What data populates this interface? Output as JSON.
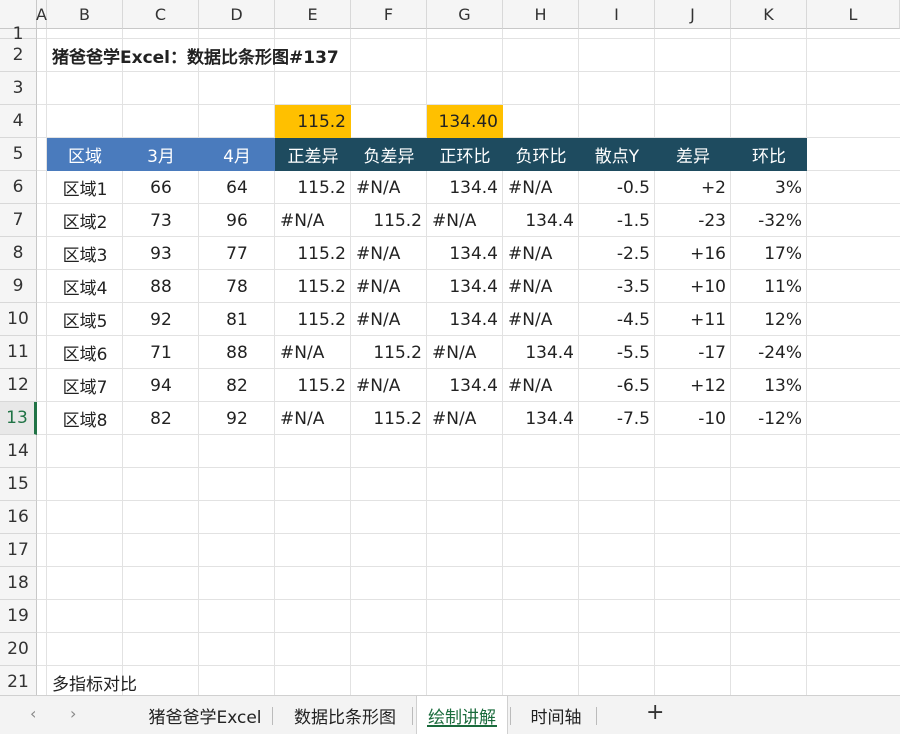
{
  "columns": [
    "A",
    "B",
    "C",
    "D",
    "E",
    "F",
    "G",
    "H",
    "I",
    "J",
    "K",
    "L"
  ],
  "rows": [
    "1",
    "2",
    "3",
    "4",
    "5",
    "6",
    "7",
    "8",
    "9",
    "10",
    "11",
    "12",
    "13",
    "14",
    "15",
    "16",
    "17",
    "18",
    "19",
    "20",
    "21"
  ],
  "active_row": "13",
  "title": "猪爸爸学Excel：数据比条形图#137",
  "highlight": {
    "e4": "115.2",
    "g4": "134.40"
  },
  "header": [
    "区域",
    "3月",
    "4月",
    "正差异",
    "负差异",
    "正环比",
    "负环比",
    "散点Y",
    "差异",
    "环比"
  ],
  "table": [
    [
      "区域1",
      "66",
      "64",
      "115.2",
      "#N/A",
      "134.4",
      "#N/A",
      "-0.5",
      "+2",
      "3%"
    ],
    [
      "区域2",
      "73",
      "96",
      "#N/A",
      "115.2",
      "#N/A",
      "134.4",
      "-1.5",
      "-23",
      "-32%"
    ],
    [
      "区域3",
      "93",
      "77",
      "115.2",
      "#N/A",
      "134.4",
      "#N/A",
      "-2.5",
      "+16",
      "17%"
    ],
    [
      "区域4",
      "88",
      "78",
      "115.2",
      "#N/A",
      "134.4",
      "#N/A",
      "-3.5",
      "+10",
      "11%"
    ],
    [
      "区域5",
      "92",
      "81",
      "115.2",
      "#N/A",
      "134.4",
      "#N/A",
      "-4.5",
      "+11",
      "12%"
    ],
    [
      "区域6",
      "71",
      "88",
      "#N/A",
      "115.2",
      "#N/A",
      "134.4",
      "-5.5",
      "-17",
      "-24%"
    ],
    [
      "区域7",
      "94",
      "82",
      "115.2",
      "#N/A",
      "134.4",
      "#N/A",
      "-6.5",
      "+12",
      "13%"
    ],
    [
      "区域8",
      "82",
      "92",
      "#N/A",
      "115.2",
      "#N/A",
      "134.4",
      "-7.5",
      "-10",
      "-12%"
    ]
  ],
  "note": "多指标对比",
  "tabs": {
    "prev_icon": "chevron-left-icon",
    "next_icon": "chevron-right-icon",
    "items": [
      "猪爸爸学Excel",
      "数据比条形图",
      "绘制讲解",
      "时间轴"
    ],
    "active_index": 2,
    "add_label": "+"
  },
  "colors": {
    "highlight": "#ffc000",
    "header_blue": "#4a7bbd",
    "header_dark": "#1e4b5f",
    "active_tab": "#1a6b3c"
  }
}
